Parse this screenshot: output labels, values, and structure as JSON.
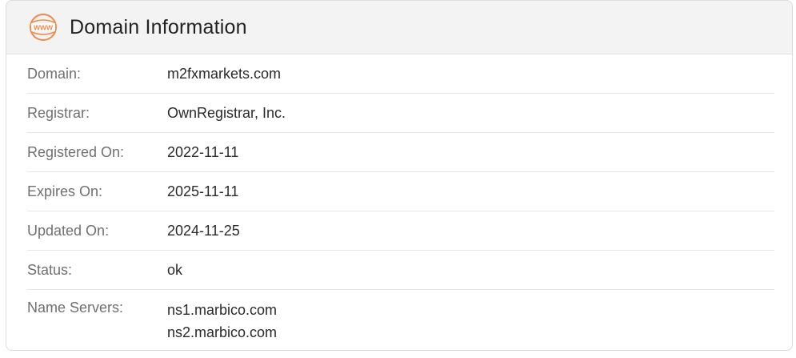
{
  "header": {
    "title": "Domain Information",
    "icon": "www-globe-icon",
    "icon_color": "#f0894a",
    "icon_text": "WWW"
  },
  "rows": [
    {
      "label": "Domain:",
      "value": "m2fxmarkets.com"
    },
    {
      "label": "Registrar:",
      "value": "OwnRegistrar, Inc."
    },
    {
      "label": "Registered On:",
      "value": "2022-11-11"
    },
    {
      "label": "Expires On:",
      "value": "2025-11-11"
    },
    {
      "label": "Updated On:",
      "value": "2024-11-25"
    },
    {
      "label": "Status:",
      "value": "ok"
    }
  ],
  "name_servers": {
    "label": "Name Servers:",
    "values": [
      "ns1.marbico.com",
      "ns2.marbico.com"
    ]
  }
}
